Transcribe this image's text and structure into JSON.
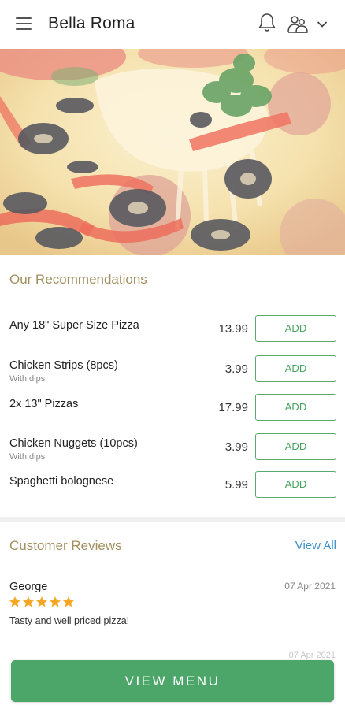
{
  "header": {
    "title": "Bella Roma",
    "icons": [
      "menu-icon",
      "bell-icon",
      "account-icon",
      "chevron-down-icon"
    ]
  },
  "hero": {
    "image": "pizza-photo"
  },
  "recommendations": {
    "title": "Our Recommendations",
    "items": [
      {
        "name": "Any 18\" Super Size Pizza",
        "sub": "",
        "price": "13.99",
        "button": "ADD"
      },
      {
        "name": "Chicken Strips (8pcs)",
        "sub": "With dips",
        "price": "3.99",
        "button": "ADD"
      },
      {
        "name": "2x 13\" Pizzas",
        "sub": "",
        "price": "17.99",
        "button": "ADD"
      },
      {
        "name": "Chicken Nuggets (10pcs)",
        "sub": "With dips",
        "price": "3.99",
        "button": "ADD"
      },
      {
        "name": "Spaghetti bolognese",
        "sub": "",
        "price": "5.99",
        "button": "ADD"
      }
    ]
  },
  "reviews": {
    "title": "Customer Reviews",
    "view_all": "View All",
    "items": [
      {
        "name": "George",
        "date": "07 Apr 2021",
        "rating": 5,
        "text": "Tasty and well priced pizza!"
      }
    ],
    "next_date_partial": "07 Apr 2021"
  },
  "cta": {
    "label": "VIEW MENU"
  },
  "colors": {
    "accent": "#4ca66a",
    "section_title": "#a38f5e",
    "link": "#3b8fc9",
    "star": "#f5a623"
  }
}
